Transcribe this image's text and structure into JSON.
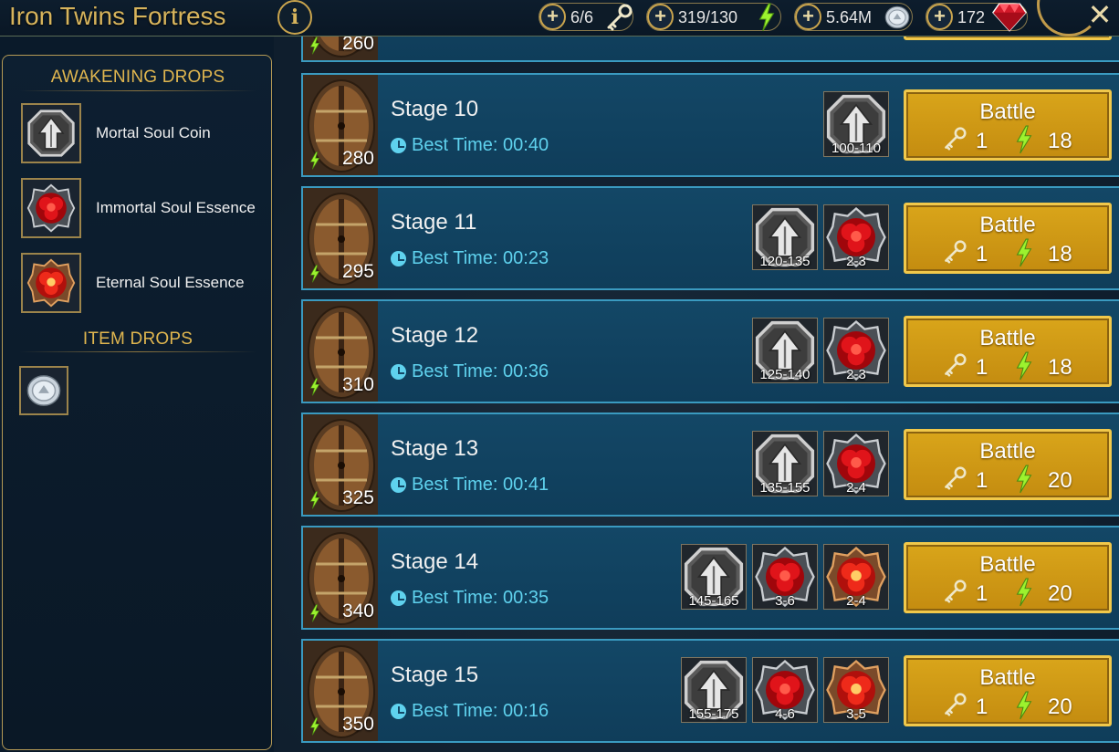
{
  "header": {
    "title": "Iron Twins Fortress",
    "info_label": "i",
    "close_label": "✕",
    "resources": [
      {
        "name": "keys",
        "value": "6/6",
        "icon": "silver-key-icon"
      },
      {
        "name": "energy",
        "value": "319/130",
        "icon": "energy-bolt-icon"
      },
      {
        "name": "silver",
        "value": "5.64M",
        "icon": "silver-coin-icon"
      },
      {
        "name": "gems",
        "value": "172",
        "icon": "ruby-gem-icon"
      }
    ],
    "plus_label": "+"
  },
  "left_panel": {
    "awakening_title": "AWAKENING DROPS",
    "awakening_items": [
      {
        "label": "Mortal Soul Coin",
        "icon": "mortal-soul-coin-icon"
      },
      {
        "label": "Immortal Soul Essence",
        "icon": "immortal-soul-essence-icon"
      },
      {
        "label": "Eternal Soul Essence",
        "icon": "eternal-soul-essence-icon"
      }
    ],
    "item_title": "ITEM DROPS",
    "item_drops": [
      {
        "icon": "silver-coin-icon"
      }
    ]
  },
  "stages": {
    "partial_power": "260",
    "list": [
      {
        "name": "Stage 10",
        "best": "Best Time: 00:40",
        "power": "280",
        "rewards": [
          {
            "icon": "mortal-soul-coin-icon",
            "qty": "100-110"
          }
        ],
        "key_cost": "1",
        "energy_cost": "18"
      },
      {
        "name": "Stage 11",
        "best": "Best Time: 00:23",
        "power": "295",
        "rewards": [
          {
            "icon": "mortal-soul-coin-icon",
            "qty": "120-135"
          },
          {
            "icon": "immortal-soul-essence-icon",
            "qty": "2-3"
          }
        ],
        "key_cost": "1",
        "energy_cost": "18"
      },
      {
        "name": "Stage 12",
        "best": "Best Time: 00:36",
        "power": "310",
        "rewards": [
          {
            "icon": "mortal-soul-coin-icon",
            "qty": "125-140"
          },
          {
            "icon": "immortal-soul-essence-icon",
            "qty": "2-3"
          }
        ],
        "key_cost": "1",
        "energy_cost": "18"
      },
      {
        "name": "Stage 13",
        "best": "Best Time: 00:41",
        "power": "325",
        "rewards": [
          {
            "icon": "mortal-soul-coin-icon",
            "qty": "135-155"
          },
          {
            "icon": "immortal-soul-essence-icon",
            "qty": "2-4"
          }
        ],
        "key_cost": "1",
        "energy_cost": "20"
      },
      {
        "name": "Stage 14",
        "best": "Best Time: 00:35",
        "power": "340",
        "rewards": [
          {
            "icon": "mortal-soul-coin-icon",
            "qty": "145-165"
          },
          {
            "icon": "immortal-soul-essence-icon",
            "qty": "3-6"
          },
          {
            "icon": "eternal-soul-essence-icon",
            "qty": "2-4"
          }
        ],
        "key_cost": "1",
        "energy_cost": "20"
      },
      {
        "name": "Stage 15",
        "best": "Best Time: 00:16",
        "power": "350",
        "rewards": [
          {
            "icon": "mortal-soul-coin-icon",
            "qty": "155-175"
          },
          {
            "icon": "immortal-soul-essence-icon",
            "qty": "4-6"
          },
          {
            "icon": "eternal-soul-essence-icon",
            "qty": "3-5"
          }
        ],
        "key_cost": "1",
        "energy_cost": "20"
      }
    ],
    "battle_label": "Battle"
  },
  "colors": {
    "gold": "#d7b45c",
    "stage_bg": "#134766",
    "time_cyan": "#5fd2ee",
    "battle_gold": "#d9a51a",
    "energy_green": "#4be04b"
  }
}
